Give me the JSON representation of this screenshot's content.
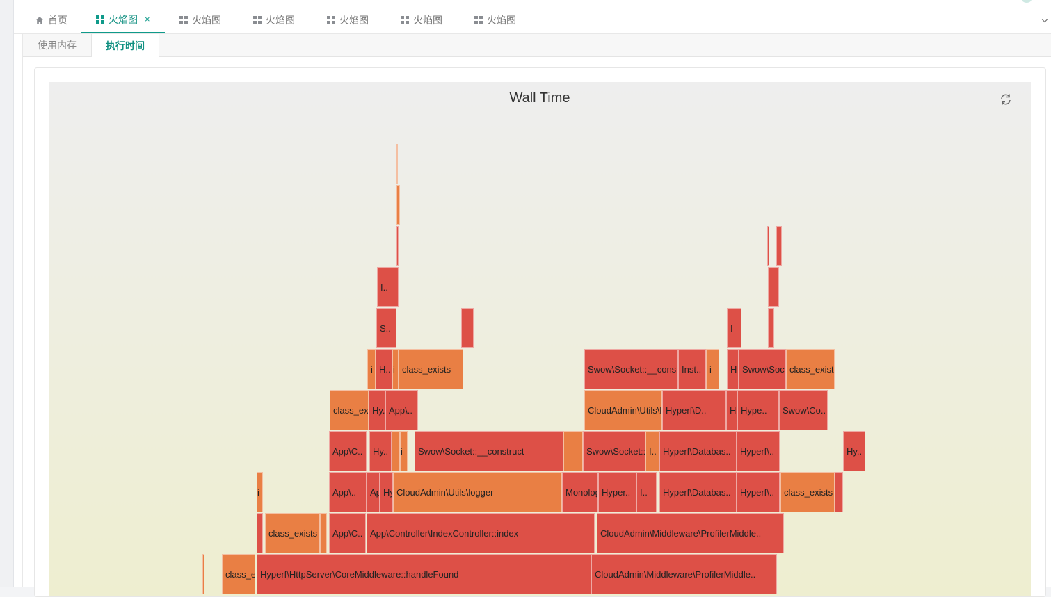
{
  "tabs": [
    {
      "label": "首页",
      "icon": "home-icon",
      "active": false,
      "closable": false
    },
    {
      "label": "火焰图",
      "icon": "grid-icon",
      "active": true,
      "closable": true
    },
    {
      "label": "火焰图",
      "icon": "grid-icon",
      "active": false,
      "closable": false
    },
    {
      "label": "火焰图",
      "icon": "grid-icon",
      "active": false,
      "closable": false
    },
    {
      "label": "火焰图",
      "icon": "grid-icon",
      "active": false,
      "closable": false
    },
    {
      "label": "火焰图",
      "icon": "grid-icon",
      "active": false,
      "closable": false
    },
    {
      "label": "火焰图",
      "icon": "grid-icon",
      "active": false,
      "closable": false
    }
  ],
  "close_glyph": "×",
  "subtabs": [
    {
      "label": "使用内存",
      "active": false
    },
    {
      "label": "执行时间",
      "active": true
    }
  ],
  "chart": {
    "title": "Wall Time",
    "refresh_icon": "refresh-icon",
    "colors": {
      "red": "#dd5047",
      "orange": "#e97f44",
      "accent": "#0f9a8a"
    }
  },
  "frames": [
    {
      "label": "class_exists",
      "level": 0,
      "start": 249,
      "end": 297,
      "color": "orange"
    },
    {
      "label": "Hyperf\\HttpServer\\CoreMiddleware::handleFound",
      "level": 0,
      "start": 299,
      "end": 780,
      "color": "red"
    },
    {
      "label": "CloudAdmin\\Middleware\\ProfilerMiddle..",
      "level": 0,
      "start": 780,
      "end": 1047,
      "color": "red"
    },
    {
      "label": "",
      "level": 0,
      "start": 221,
      "end": 224,
      "color": "orange"
    },
    {
      "label": "",
      "level": 1,
      "start": 299,
      "end": 308,
      "color": "red"
    },
    {
      "label": "class_exists",
      "level": 1,
      "start": 311,
      "end": 390,
      "color": "orange"
    },
    {
      "label": "",
      "level": 1,
      "start": 390,
      "end": 400,
      "color": "orange"
    },
    {
      "label": "App\\C..",
      "level": 1,
      "start": 403,
      "end": 456,
      "color": "red"
    },
    {
      "label": "App\\Controller\\IndexController::index",
      "level": 1,
      "start": 457,
      "end": 785,
      "color": "red"
    },
    {
      "label": "CloudAdmin\\Middleware\\ProfilerMiddle..",
      "level": 1,
      "start": 788,
      "end": 1057,
      "color": "red"
    },
    {
      "label": "i",
      "level": 2,
      "start": 299,
      "end": 308,
      "color": "orange"
    },
    {
      "label": "App\\..",
      "level": 2,
      "start": 403,
      "end": 457,
      "color": "red"
    },
    {
      "label": "App\\C..",
      "level": 2,
      "start": 457,
      "end": 476,
      "color": "red"
    },
    {
      "label": "Hy..",
      "level": 2,
      "start": 476,
      "end": 495,
      "color": "red"
    },
    {
      "label": "CloudAdmin\\Utils\\logger",
      "level": 2,
      "start": 495,
      "end": 738,
      "color": "orange"
    },
    {
      "label": "Monolog\\Lo..",
      "level": 2,
      "start": 738,
      "end": 790,
      "color": "red"
    },
    {
      "label": "Hyper..",
      "level": 2,
      "start": 790,
      "end": 845,
      "color": "red"
    },
    {
      "label": "I..",
      "level": 2,
      "start": 845,
      "end": 874,
      "color": "red"
    },
    {
      "label": "Hyperf\\Databas..",
      "level": 2,
      "start": 878,
      "end": 989,
      "color": "red"
    },
    {
      "label": "Hyperf\\..",
      "level": 2,
      "start": 989,
      "end": 1051,
      "color": "red"
    },
    {
      "label": "class_exists",
      "level": 2,
      "start": 1052,
      "end": 1130,
      "color": "orange"
    },
    {
      "label": "",
      "level": 2,
      "start": 1130,
      "end": 1142,
      "color": "red"
    },
    {
      "label": "App\\C..",
      "level": 3,
      "start": 403,
      "end": 457,
      "color": "red"
    },
    {
      "label": "Hy..",
      "level": 3,
      "start": 461,
      "end": 493,
      "color": "red"
    },
    {
      "label": "",
      "level": 3,
      "start": 493,
      "end": 505,
      "color": "orange"
    },
    {
      "label": "i",
      "level": 3,
      "start": 505,
      "end": 516,
      "color": "orange"
    },
    {
      "label": "Swow\\Socket::__construct",
      "level": 3,
      "start": 526,
      "end": 740,
      "color": "red"
    },
    {
      "label": "",
      "level": 3,
      "start": 740,
      "end": 768,
      "color": "orange"
    },
    {
      "label": "Swow\\Socket::__..",
      "level": 3,
      "start": 768,
      "end": 858,
      "color": "red"
    },
    {
      "label": "I..",
      "level": 3,
      "start": 858,
      "end": 878,
      "color": "orange"
    },
    {
      "label": "Hyperf\\Databas..",
      "level": 3,
      "start": 878,
      "end": 989,
      "color": "red"
    },
    {
      "label": "Hyperf\\..",
      "level": 3,
      "start": 989,
      "end": 1051,
      "color": "red"
    },
    {
      "label": "Hy..",
      "level": 3,
      "start": 1142,
      "end": 1174,
      "color": "red"
    },
    {
      "label": "class_exists",
      "level": 4,
      "start": 404,
      "end": 460,
      "color": "orange"
    },
    {
      "label": "Hy..",
      "level": 4,
      "start": 460,
      "end": 484,
      "color": "red"
    },
    {
      "label": "App\\..",
      "level": 4,
      "start": 484,
      "end": 531,
      "color": "red"
    },
    {
      "label": "CloudAdmin\\Utils\\logger",
      "level": 4,
      "start": 770,
      "end": 882,
      "color": "orange"
    },
    {
      "label": "Hyperf\\D..",
      "level": 4,
      "start": 882,
      "end": 974,
      "color": "red"
    },
    {
      "label": "H",
      "level": 4,
      "start": 974,
      "end": 990,
      "color": "red"
    },
    {
      "label": "Hype..",
      "level": 4,
      "start": 990,
      "end": 1050,
      "color": "red"
    },
    {
      "label": "Swow\\Co..",
      "level": 4,
      "start": 1050,
      "end": 1120,
      "color": "red"
    },
    {
      "label": "i",
      "level": 5,
      "start": 458,
      "end": 470,
      "color": "orange"
    },
    {
      "label": "H..",
      "level": 5,
      "start": 470,
      "end": 494,
      "color": "red"
    },
    {
      "label": "i",
      "level": 5,
      "start": 494,
      "end": 503,
      "color": "orange"
    },
    {
      "label": "class_exists",
      "level": 5,
      "start": 503,
      "end": 596,
      "color": "orange"
    },
    {
      "label": "Swow\\Socket::__construct",
      "level": 5,
      "start": 770,
      "end": 905,
      "color": "red"
    },
    {
      "label": "Inst..",
      "level": 5,
      "start": 905,
      "end": 945,
      "color": "red"
    },
    {
      "label": "i",
      "level": 5,
      "start": 945,
      "end": 964,
      "color": "orange"
    },
    {
      "label": "H",
      "level": 5,
      "start": 975,
      "end": 992,
      "color": "red"
    },
    {
      "label": "Swow\\Socket::__c..",
      "level": 5,
      "start": 992,
      "end": 1060,
      "color": "red"
    },
    {
      "label": "class_exists",
      "level": 5,
      "start": 1060,
      "end": 1130,
      "color": "orange"
    },
    {
      "label": "S..",
      "level": 6,
      "start": 471,
      "end": 500,
      "color": "red"
    },
    {
      "label": "",
      "level": 6,
      "start": 593,
      "end": 611,
      "color": "red"
    },
    {
      "label": "I",
      "level": 6,
      "start": 975,
      "end": 996,
      "color": "red"
    },
    {
      "label": "",
      "level": 6,
      "start": 1034,
      "end": 1043,
      "color": "red"
    },
    {
      "label": "I..",
      "level": 7,
      "start": 472,
      "end": 503,
      "color": "red"
    },
    {
      "label": "",
      "level": 7,
      "start": 1034,
      "end": 1050,
      "color": "red"
    },
    {
      "label": "",
      "level": 8,
      "start": 500,
      "end": 503,
      "color": "red"
    },
    {
      "label": "",
      "level": 8,
      "start": 1033,
      "end": 1036,
      "color": "red"
    },
    {
      "label": "",
      "level": 8,
      "start": 1046,
      "end": 1054,
      "color": "red"
    },
    {
      "label": "",
      "level": 9,
      "start": 500,
      "end": 505,
      "color": "orange"
    },
    {
      "label": "",
      "level": 10,
      "start": 500,
      "end": 502,
      "color": "orange"
    }
  ]
}
